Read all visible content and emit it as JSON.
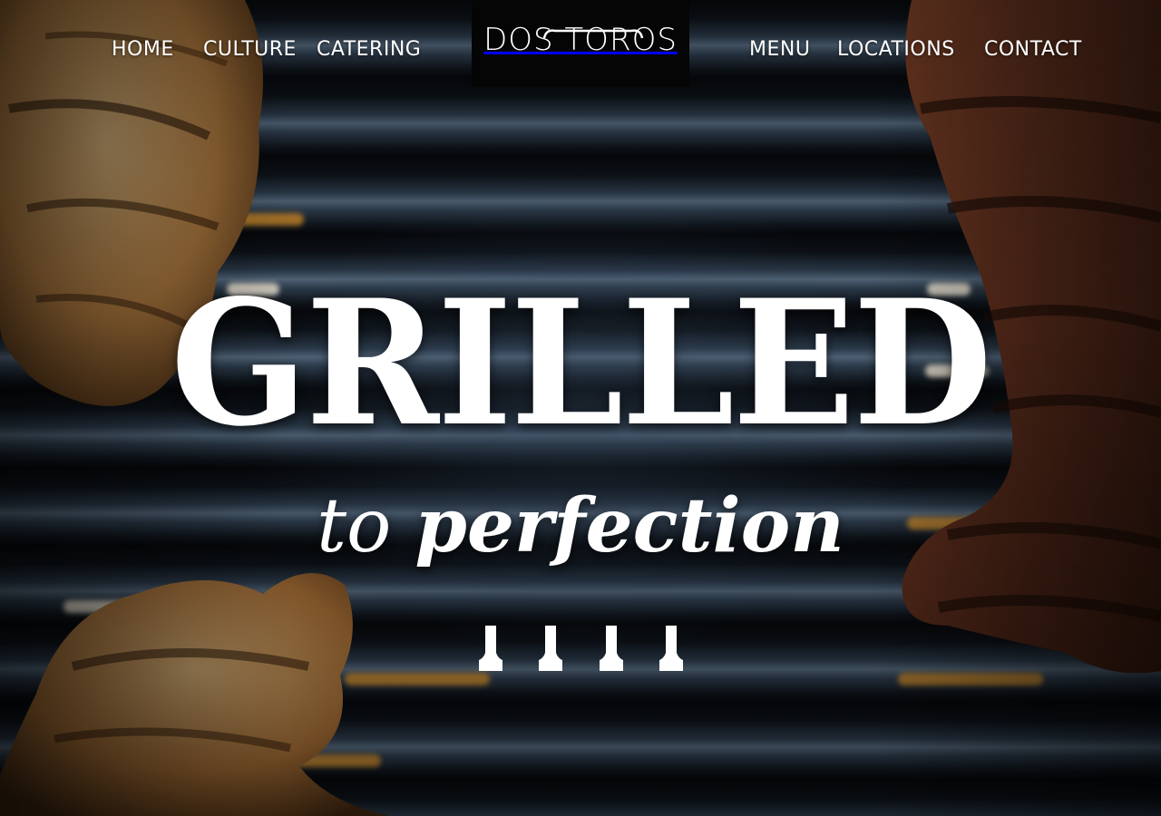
{
  "nav": {
    "left": [
      {
        "label": "HOME"
      },
      {
        "label": "CULTURE"
      },
      {
        "label": "CATERING"
      }
    ],
    "right": [
      {
        "label": "MENU"
      },
      {
        "label": "LOCATIONS"
      },
      {
        "label": "CONTACT"
      }
    ]
  },
  "logo": {
    "text": "DOS TOROS"
  },
  "hero": {
    "headline": "GRILLED",
    "tagline_light": "to",
    "tagline_bold": "perfection",
    "slide_count": 4
  },
  "colors": {
    "text": "#ffffff",
    "logo_bg": "#050505",
    "grill_dark": "#0b0f14",
    "flame": "#e4982a"
  }
}
